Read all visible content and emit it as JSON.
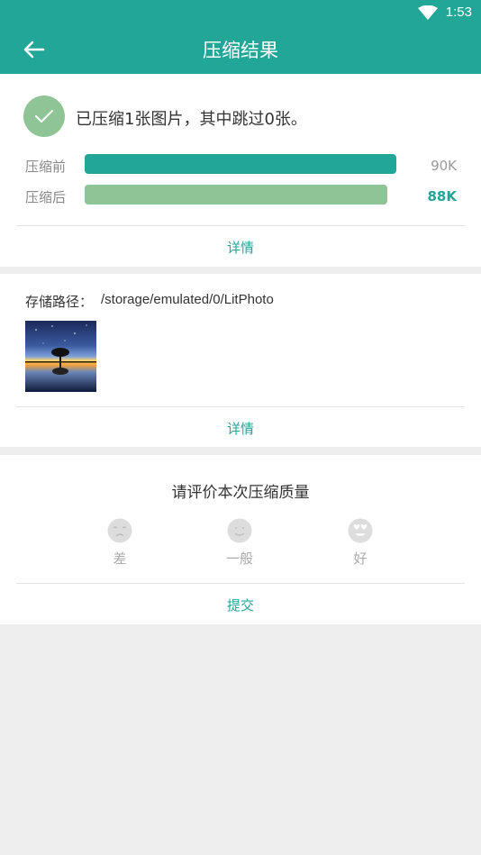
{
  "status_bar": {
    "time": "1:53",
    "wifi_icon": "wifi-icon"
  },
  "app_bar": {
    "title": "压缩结果",
    "back_icon": "arrow-left-icon"
  },
  "summary": {
    "text": "已压缩1张图片，其中跳过0张。",
    "before_label": "压缩前",
    "before_value": "90K",
    "after_label": "压缩后",
    "after_value": "88K",
    "before_ratio": 1.0,
    "after_ratio": 0.97,
    "colors": {
      "before_bar": "#22a698",
      "after_bar": "#8fc596",
      "after_value": "#22a698"
    },
    "details_label": "详情"
  },
  "storage": {
    "path_label": "存储路径：",
    "path_value": "/storage/emulated/0/LitPhoto",
    "details_label": "详情"
  },
  "rating": {
    "title": "请评价本次压缩质量",
    "options": [
      {
        "label": "差",
        "icon": "sad-face-icon"
      },
      {
        "label": "一般",
        "icon": "neutral-face-icon"
      },
      {
        "label": "好",
        "icon": "heart-eyes-face-icon"
      }
    ],
    "submit_label": "提交"
  },
  "colors": {
    "accent": "#22a698",
    "background": "#eeeeee"
  }
}
